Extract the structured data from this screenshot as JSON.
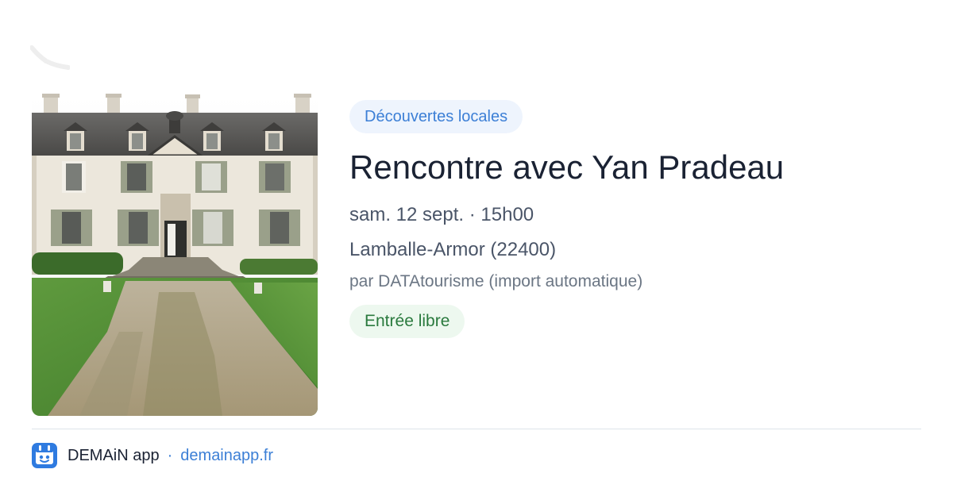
{
  "event": {
    "category": "Découvertes locales",
    "title": "Rencontre avec Yan Pradeau",
    "datetime": "sam. 12 sept. · 15h00",
    "location": "Lamballe-Armor (22400)",
    "source": "par DATAtourisme (import automatique)",
    "price": "Entrée libre"
  },
  "footer": {
    "app_name": "DEMAiN app",
    "separator": "·",
    "url": "demainapp.fr"
  },
  "icons": {
    "app_logo": "demain-app-logo-icon",
    "photo": "chateau-photo"
  },
  "colors": {
    "category_bg": "#eef4fd",
    "category_text": "#3c7fd6",
    "price_bg": "#edf8ef",
    "price_text": "#2a7a3e",
    "title": "#1a2233",
    "link": "#3c7fd6"
  }
}
